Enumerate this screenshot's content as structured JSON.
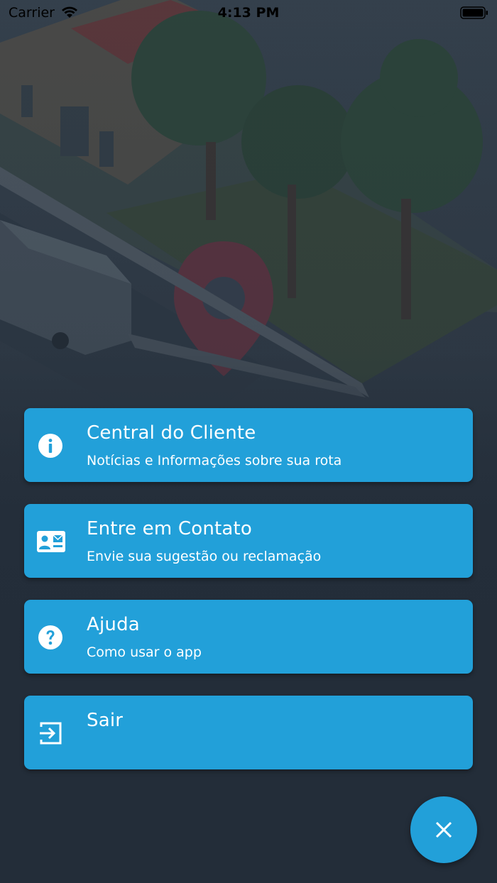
{
  "status_bar": {
    "carrier": "Carrier",
    "time": "4:13 PM"
  },
  "menu": [
    {
      "title": "Central do Cliente",
      "subtitle": "Notícias e Informações sobre sua rota",
      "icon": "info-icon"
    },
    {
      "title": "Entre em Contato",
      "subtitle": "Envie sua sugestão ou reclamação",
      "icon": "contact-card-icon"
    },
    {
      "title": "Ajuda",
      "subtitle": "Como usar o app",
      "icon": "help-icon"
    },
    {
      "title": "Sair",
      "subtitle": "",
      "icon": "logout-icon"
    }
  ],
  "fab": {
    "icon": "close-icon"
  },
  "colors": {
    "accent": "#22a0d9",
    "background": "#232d39"
  }
}
